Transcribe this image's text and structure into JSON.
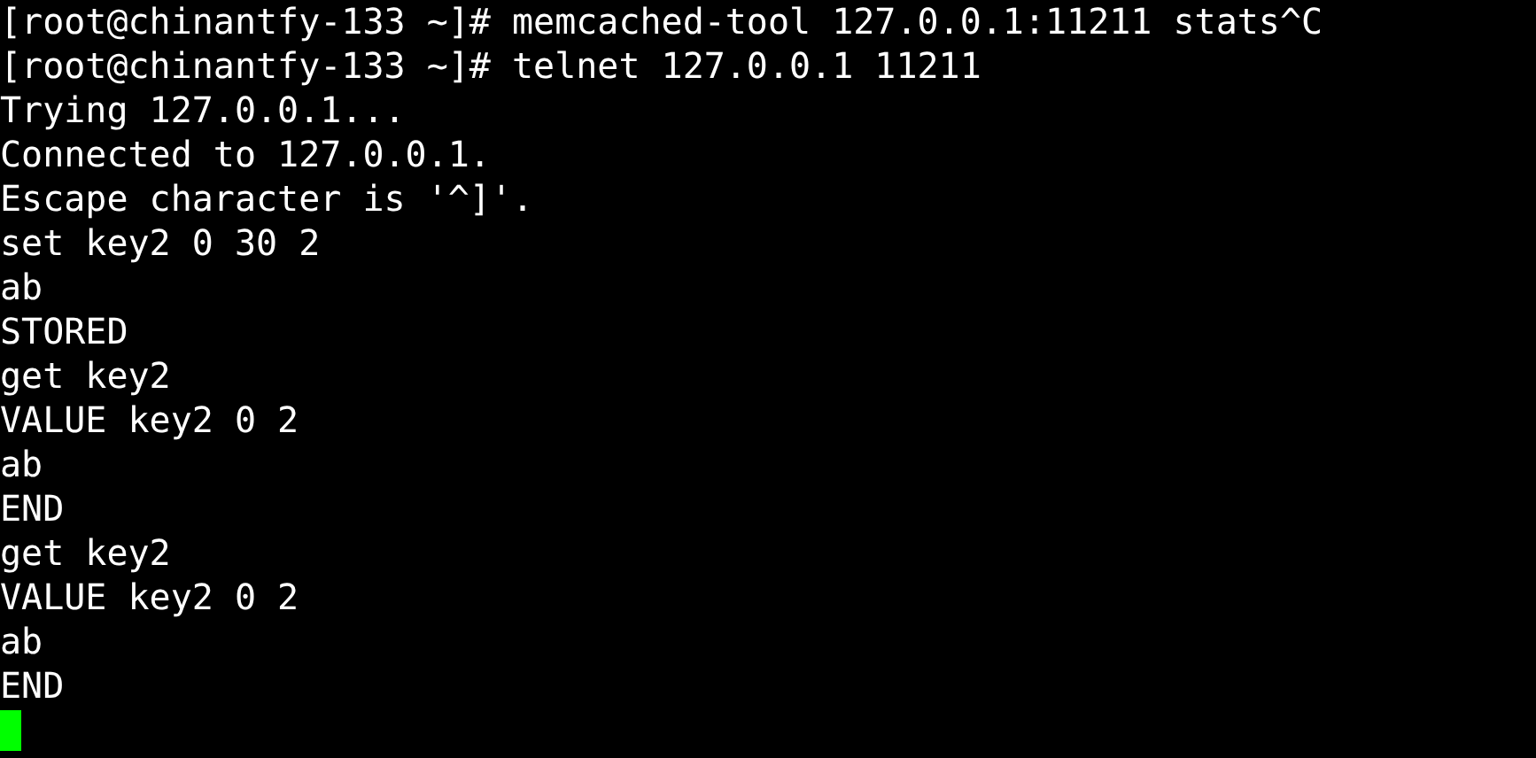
{
  "terminal": {
    "lines": [
      "[root@chinantfy-133 ~]# memcached-tool 127.0.0.1:11211 stats^C",
      "[root@chinantfy-133 ~]# telnet 127.0.0.1 11211",
      "Trying 127.0.0.1...",
      "Connected to 127.0.0.1.",
      "Escape character is '^]'.",
      "set key2 0 30 2",
      "ab",
      "STORED",
      "get key2",
      "VALUE key2 0 2",
      "ab",
      "END",
      "get key2",
      "VALUE key2 0 2",
      "ab",
      "END"
    ],
    "cursor": true
  }
}
